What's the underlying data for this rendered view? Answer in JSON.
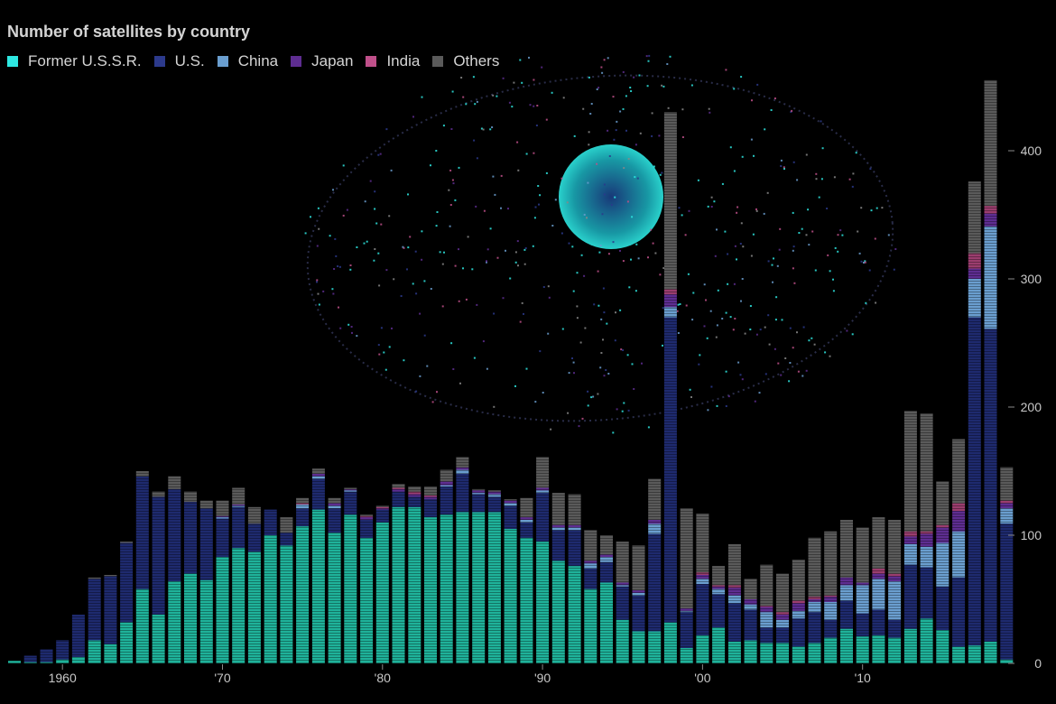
{
  "chart_data": {
    "type": "bar",
    "stacked": true,
    "title": "Number of satellites by country",
    "xlabel": "",
    "ylabel": "",
    "ylim": [
      0,
      400
    ],
    "yticks": [
      0,
      100,
      200,
      300,
      400
    ],
    "xtick_labels": [
      {
        "year": 1960,
        "label": "1960"
      },
      {
        "year": 1970,
        "label": "'70"
      },
      {
        "year": 1980,
        "label": "'80"
      },
      {
        "year": 1990,
        "label": "'90"
      },
      {
        "year": 2000,
        "label": "'00"
      },
      {
        "year": 2010,
        "label": "'10"
      }
    ],
    "legend_placement": "top-left",
    "grid": false,
    "categories": [
      1957,
      1958,
      1959,
      1960,
      1961,
      1962,
      1963,
      1964,
      1965,
      1966,
      1967,
      1968,
      1969,
      1970,
      1971,
      1972,
      1973,
      1974,
      1975,
      1976,
      1977,
      1978,
      1979,
      1980,
      1981,
      1982,
      1983,
      1984,
      1985,
      1986,
      1987,
      1988,
      1989,
      1990,
      1991,
      1992,
      1993,
      1994,
      1995,
      1996,
      1997,
      1998,
      1999,
      2000,
      2001,
      2002,
      2003,
      2004,
      2005,
      2006,
      2007,
      2008,
      2009,
      2010,
      2011,
      2012,
      2013,
      2014,
      2015,
      2016,
      2017,
      2018,
      2019
    ],
    "series": [
      {
        "name": "Former U.S.S.R.",
        "color": "#1fb29a",
        "values": [
          2,
          1,
          1,
          3,
          5,
          18,
          15,
          32,
          58,
          38,
          64,
          70,
          65,
          83,
          90,
          87,
          100,
          92,
          107,
          120,
          102,
          116,
          98,
          110,
          122,
          122,
          114,
          116,
          118,
          118,
          118,
          105,
          98,
          95,
          80,
          76,
          58,
          63,
          34,
          25,
          25,
          32,
          12,
          22,
          28,
          17,
          18,
          16,
          16,
          13,
          16,
          20,
          27,
          21,
          22,
          20,
          27,
          35,
          26,
          13,
          14,
          17,
          3
        ]
      },
      {
        "name": "U.S.",
        "color": "#1e2a6e",
        "values": [
          0,
          5,
          10,
          15,
          33,
          48,
          53,
          62,
          88,
          92,
          72,
          56,
          56,
          30,
          32,
          22,
          20,
          10,
          14,
          24,
          19,
          18,
          14,
          10,
          12,
          8,
          14,
          22,
          30,
          14,
          12,
          18,
          12,
          38,
          24,
          28,
          16,
          16,
          26,
          28,
          76,
          238,
          28,
          40,
          26,
          30,
          24,
          12,
          12,
          22,
          24,
          14,
          22,
          18,
          20,
          14,
          50,
          40,
          34,
          54,
          256,
          244,
          106
        ]
      },
      {
        "name": "China",
        "color": "#6a9ecf",
        "values": [
          0,
          0,
          0,
          0,
          0,
          0,
          0,
          0,
          0,
          0,
          0,
          0,
          0,
          1,
          1,
          0,
          0,
          0,
          3,
          2,
          2,
          1,
          0,
          0,
          0,
          0,
          0,
          1,
          3,
          1,
          2,
          2,
          2,
          2,
          2,
          2,
          4,
          4,
          1,
          2,
          8,
          8,
          1,
          4,
          4,
          6,
          4,
          12,
          6,
          6,
          8,
          14,
          12,
          22,
          24,
          30,
          16,
          16,
          34,
          36,
          30,
          80,
          12
        ]
      },
      {
        "name": "Japan",
        "color": "#5e2d91",
        "values": [
          0,
          0,
          0,
          0,
          0,
          0,
          0,
          0,
          0,
          0,
          0,
          0,
          0,
          1,
          1,
          0,
          0,
          0,
          0,
          2,
          2,
          1,
          2,
          1,
          2,
          2,
          2,
          3,
          2,
          2,
          2,
          2,
          2,
          2,
          2,
          2,
          2,
          2,
          2,
          2,
          3,
          10,
          2,
          3,
          2,
          6,
          4,
          4,
          4,
          6,
          2,
          4,
          6,
          2,
          4,
          4,
          6,
          10,
          12,
          16,
          8,
          10,
          4
        ]
      },
      {
        "name": "India",
        "color": "#9b3d6e",
        "values": [
          0,
          0,
          0,
          0,
          0,
          0,
          0,
          0,
          0,
          0,
          0,
          0,
          0,
          0,
          0,
          0,
          0,
          0,
          1,
          0,
          0,
          0,
          1,
          1,
          1,
          2,
          1,
          0,
          0,
          0,
          0,
          0,
          0,
          0,
          0,
          0,
          0,
          0,
          0,
          0,
          0,
          4,
          0,
          2,
          1,
          2,
          0,
          1,
          2,
          2,
          2,
          1,
          0,
          0,
          4,
          2,
          4,
          2,
          2,
          6,
          12,
          6,
          2
        ]
      },
      {
        "name": "Others",
        "color": "#5a5a5a",
        "values": [
          0,
          0,
          0,
          0,
          0,
          1,
          1,
          1,
          4,
          4,
          10,
          8,
          6,
          12,
          13,
          13,
          0,
          12,
          4,
          4,
          4,
          1,
          1,
          1,
          3,
          4,
          7,
          9,
          8,
          1,
          1,
          1,
          15,
          24,
          25,
          24,
          24,
          15,
          32,
          35,
          32,
          138,
          78,
          46,
          15,
          32,
          16,
          32,
          30,
          32,
          46,
          50,
          45,
          43,
          40,
          42,
          94,
          92,
          34,
          50,
          56,
          98,
          26
        ]
      }
    ]
  }
}
